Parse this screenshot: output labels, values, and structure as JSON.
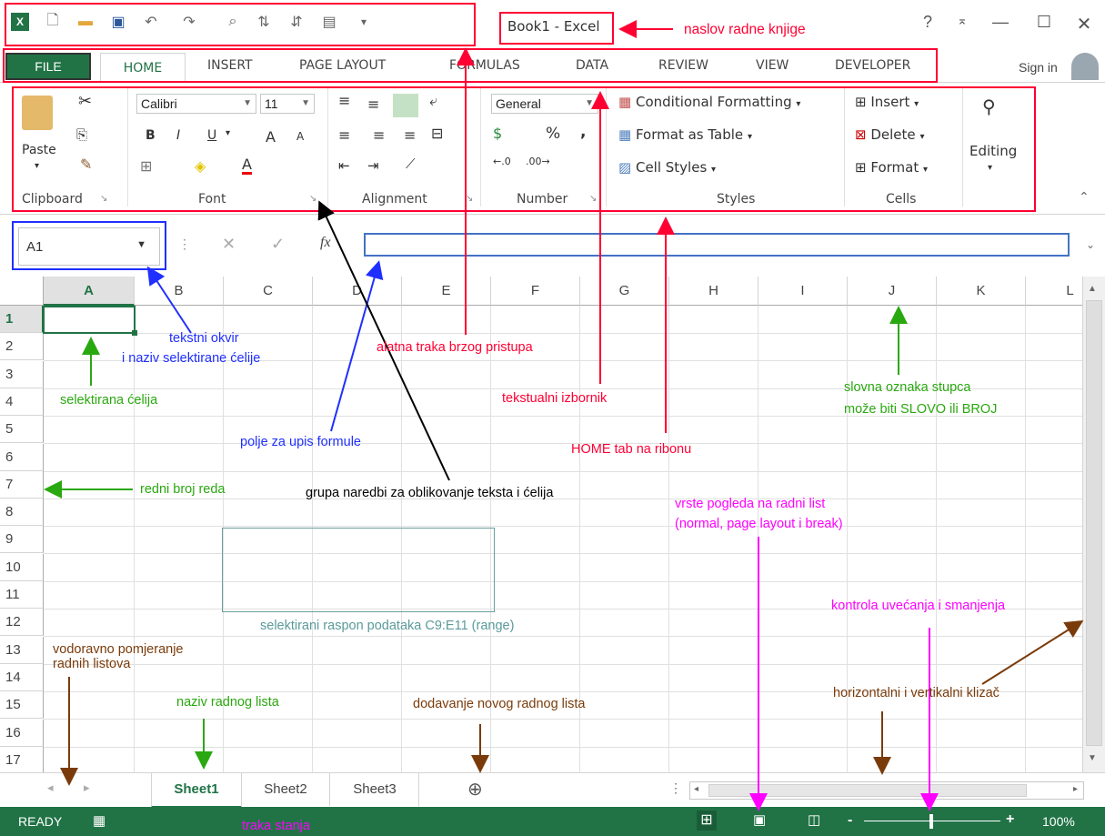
{
  "window": {
    "title": "Book1 - Excel",
    "help": "?",
    "ribbon_display": "⌅",
    "minimize": "—",
    "maximize": "☐",
    "close": "✕"
  },
  "tabs": [
    "FILE",
    "HOME",
    "INSERT",
    "PAGE LAYOUT",
    "FORMULAS",
    "DATA",
    "REVIEW",
    "VIEW",
    "DEVELOPER"
  ],
  "signin": "Sign in",
  "ribbon": {
    "clipboard": {
      "paste": "Paste",
      "label": "Clipboard"
    },
    "font": {
      "name": "Calibri",
      "size": "11",
      "bold": "B",
      "italic": "I",
      "underline": "U",
      "grow": "A",
      "shrink": "A",
      "color_a": "A",
      "label": "Font"
    },
    "alignment": {
      "label": "Alignment"
    },
    "number": {
      "format": "General",
      "percent": "%",
      "comma": ",",
      "label": "Number"
    },
    "styles": {
      "conditional": "Conditional Formatting",
      "table": "Format as Table",
      "cell_styles": "Cell Styles",
      "label": "Styles"
    },
    "cells": {
      "insert": "Insert",
      "delete": "Delete",
      "format": "Format",
      "label": "Cells"
    },
    "editing": {
      "label": "Editing"
    }
  },
  "formula_bar": {
    "name_box": "A1",
    "fx": "fx",
    "cancel": "✕",
    "enter": "✓"
  },
  "columns": [
    "A",
    "B",
    "C",
    "D",
    "E",
    "F",
    "G",
    "H",
    "I",
    "J",
    "K",
    "L"
  ],
  "rows": [
    "1",
    "2",
    "3",
    "4",
    "5",
    "6",
    "7",
    "8",
    "9",
    "10",
    "11",
    "12",
    "13",
    "14",
    "15",
    "16",
    "17"
  ],
  "sheets": [
    "Sheet1",
    "Sheet2",
    "Sheet3"
  ],
  "add_sheet": "⊕",
  "status": {
    "ready": "READY",
    "zoom": "100%",
    "zoom_minus": "-",
    "zoom_plus": "+"
  },
  "annotations": {
    "title": "naslov radne knjige",
    "textbox_1": "tekstni okvir",
    "textbox_2": "i naziv selektirane ćelije",
    "qat": "alatna traka brzog pristupa",
    "col_label_1": "slovna oznaka stupca",
    "col_label_2": "može biti SLOVO ili BROJ",
    "selected_cell": "selektirana ćelija",
    "text_menu": "tekstualni izbornik",
    "formula_field": "polje za upis formule",
    "home_tab": "HOME tab na ribonu",
    "row_number": "redni broj reda",
    "format_group": "grupa naredbi za oblikovanje teksta i ćelija",
    "views_1": "vrste pogleda na radni list",
    "views_2": "(normal, page layout i break)",
    "range": "selektirani raspon podataka C9:E11 (range)",
    "zoom": "kontrola uvećanja i smanjenja",
    "scroll_sheets_1": "vodoravno pomjeranje",
    "scroll_sheets_2": "radnih listova",
    "sheet_name": "naziv radnog lista",
    "add_sheet": "dodavanje novog radnog lista",
    "scrollbars": "horizontalni i vertikalni klizač",
    "status_bar": "traka stanja"
  }
}
